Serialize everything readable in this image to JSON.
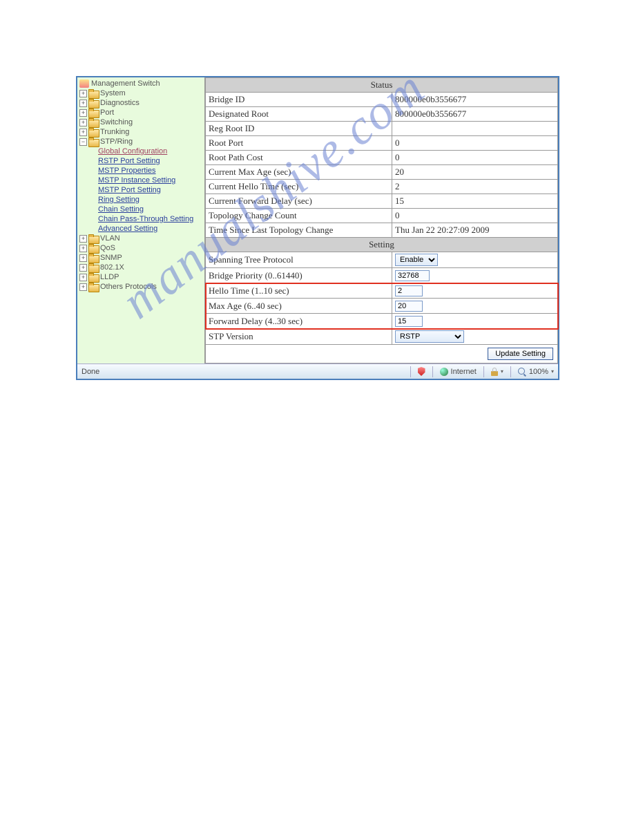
{
  "watermark": "manualshive.com",
  "sidebar": {
    "root": "Management Switch",
    "items": [
      {
        "label": "System",
        "expandable": true,
        "expanded": false
      },
      {
        "label": "Diagnostics",
        "expandable": true,
        "expanded": false
      },
      {
        "label": "Port",
        "expandable": true,
        "expanded": false
      },
      {
        "label": "Switching",
        "expandable": true,
        "expanded": false
      },
      {
        "label": "Trunking",
        "expandable": true,
        "expanded": false
      },
      {
        "label": "STP/Ring",
        "expandable": true,
        "expanded": true,
        "children": [
          {
            "label": "Global Configuration",
            "active": true
          },
          {
            "label": "RSTP Port Setting"
          },
          {
            "label": "MSTP Properties"
          },
          {
            "label": "MSTP Instance Setting"
          },
          {
            "label": "MSTP Port Setting"
          },
          {
            "label": "Ring Setting"
          },
          {
            "label": "Chain Setting"
          },
          {
            "label": "Chain Pass-Through Setting"
          },
          {
            "label": "Advanced Setting"
          }
        ]
      },
      {
        "label": "VLAN",
        "expandable": true,
        "expanded": false
      },
      {
        "label": "QoS",
        "expandable": true,
        "expanded": false
      },
      {
        "label": "SNMP",
        "expandable": true,
        "expanded": false
      },
      {
        "label": "802.1X",
        "expandable": true,
        "expanded": false
      },
      {
        "label": "LLDP",
        "expandable": true,
        "expanded": false
      },
      {
        "label": "Others Protocols",
        "expandable": true,
        "expanded": false
      }
    ]
  },
  "status": {
    "header": "Status",
    "rows": [
      {
        "label": "Bridge ID",
        "value": "800000e0b3556677"
      },
      {
        "label": "Designated Root",
        "value": "800000e0b3556677"
      },
      {
        "label": "Reg Root ID",
        "value": ""
      },
      {
        "label": "Root Port",
        "value": "0"
      },
      {
        "label": "Root Path Cost",
        "value": "0"
      },
      {
        "label": "Current Max Age (sec)",
        "value": "20"
      },
      {
        "label": "Current Hello Time (sec)",
        "value": "2"
      },
      {
        "label": "Current Forward Delay (sec)",
        "value": "15"
      },
      {
        "label": "Topology Change Count",
        "value": "0"
      },
      {
        "label": "Time Since Last Topology Change",
        "value": "Thu Jan 22 20:27:09 2009"
      }
    ]
  },
  "setting": {
    "header": "Setting",
    "stp_label": "Spanning Tree Protocol",
    "stp_value": "Enable",
    "priority_label": "Bridge Priority (0..61440)",
    "priority_value": "32768",
    "hello_label": "Hello Time (1..10 sec)",
    "hello_value": "2",
    "maxage_label": "Max Age (6..40 sec)",
    "maxage_value": "20",
    "fwd_label": "Forward Delay (4..30 sec)",
    "fwd_value": "15",
    "version_label": "STP Version",
    "version_value": "RSTP",
    "button": "Update Setting"
  },
  "statusbar": {
    "done": "Done",
    "zone": "Internet",
    "zoom": "100%"
  }
}
